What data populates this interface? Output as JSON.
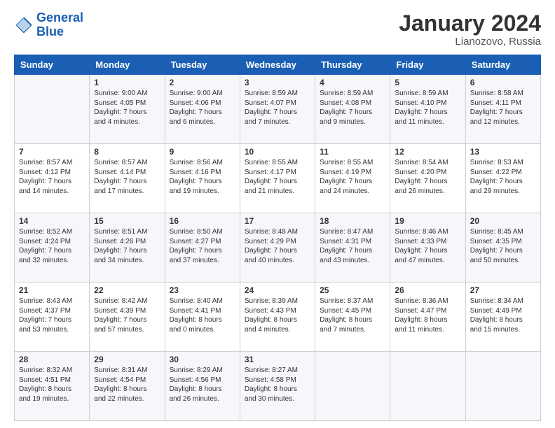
{
  "header": {
    "logo_general": "General",
    "logo_blue": "Blue",
    "month_title": "January 2024",
    "location": "Lianozovo, Russia"
  },
  "weekdays": [
    "Sunday",
    "Monday",
    "Tuesday",
    "Wednesday",
    "Thursday",
    "Friday",
    "Saturday"
  ],
  "weeks": [
    [
      {
        "day": "",
        "info": ""
      },
      {
        "day": "1",
        "info": "Sunrise: 9:00 AM\nSunset: 4:05 PM\nDaylight: 7 hours\nand 4 minutes."
      },
      {
        "day": "2",
        "info": "Sunrise: 9:00 AM\nSunset: 4:06 PM\nDaylight: 7 hours\nand 6 minutes."
      },
      {
        "day": "3",
        "info": "Sunrise: 8:59 AM\nSunset: 4:07 PM\nDaylight: 7 hours\nand 7 minutes."
      },
      {
        "day": "4",
        "info": "Sunrise: 8:59 AM\nSunset: 4:08 PM\nDaylight: 7 hours\nand 9 minutes."
      },
      {
        "day": "5",
        "info": "Sunrise: 8:59 AM\nSunset: 4:10 PM\nDaylight: 7 hours\nand 11 minutes."
      },
      {
        "day": "6",
        "info": "Sunrise: 8:58 AM\nSunset: 4:11 PM\nDaylight: 7 hours\nand 12 minutes."
      }
    ],
    [
      {
        "day": "7",
        "info": "Sunrise: 8:57 AM\nSunset: 4:12 PM\nDaylight: 7 hours\nand 14 minutes."
      },
      {
        "day": "8",
        "info": "Sunrise: 8:57 AM\nSunset: 4:14 PM\nDaylight: 7 hours\nand 17 minutes."
      },
      {
        "day": "9",
        "info": "Sunrise: 8:56 AM\nSunset: 4:16 PM\nDaylight: 7 hours\nand 19 minutes."
      },
      {
        "day": "10",
        "info": "Sunrise: 8:55 AM\nSunset: 4:17 PM\nDaylight: 7 hours\nand 21 minutes."
      },
      {
        "day": "11",
        "info": "Sunrise: 8:55 AM\nSunset: 4:19 PM\nDaylight: 7 hours\nand 24 minutes."
      },
      {
        "day": "12",
        "info": "Sunrise: 8:54 AM\nSunset: 4:20 PM\nDaylight: 7 hours\nand 26 minutes."
      },
      {
        "day": "13",
        "info": "Sunrise: 8:53 AM\nSunset: 4:22 PM\nDaylight: 7 hours\nand 29 minutes."
      }
    ],
    [
      {
        "day": "14",
        "info": "Sunrise: 8:52 AM\nSunset: 4:24 PM\nDaylight: 7 hours\nand 32 minutes."
      },
      {
        "day": "15",
        "info": "Sunrise: 8:51 AM\nSunset: 4:26 PM\nDaylight: 7 hours\nand 34 minutes."
      },
      {
        "day": "16",
        "info": "Sunrise: 8:50 AM\nSunset: 4:27 PM\nDaylight: 7 hours\nand 37 minutes."
      },
      {
        "day": "17",
        "info": "Sunrise: 8:48 AM\nSunset: 4:29 PM\nDaylight: 7 hours\nand 40 minutes."
      },
      {
        "day": "18",
        "info": "Sunrise: 8:47 AM\nSunset: 4:31 PM\nDaylight: 7 hours\nand 43 minutes."
      },
      {
        "day": "19",
        "info": "Sunrise: 8:46 AM\nSunset: 4:33 PM\nDaylight: 7 hours\nand 47 minutes."
      },
      {
        "day": "20",
        "info": "Sunrise: 8:45 AM\nSunset: 4:35 PM\nDaylight: 7 hours\nand 50 minutes."
      }
    ],
    [
      {
        "day": "21",
        "info": "Sunrise: 8:43 AM\nSunset: 4:37 PM\nDaylight: 7 hours\nand 53 minutes."
      },
      {
        "day": "22",
        "info": "Sunrise: 8:42 AM\nSunset: 4:39 PM\nDaylight: 7 hours\nand 57 minutes."
      },
      {
        "day": "23",
        "info": "Sunrise: 8:40 AM\nSunset: 4:41 PM\nDaylight: 8 hours\nand 0 minutes."
      },
      {
        "day": "24",
        "info": "Sunrise: 8:39 AM\nSunset: 4:43 PM\nDaylight: 8 hours\nand 4 minutes."
      },
      {
        "day": "25",
        "info": "Sunrise: 8:37 AM\nSunset: 4:45 PM\nDaylight: 8 hours\nand 7 minutes."
      },
      {
        "day": "26",
        "info": "Sunrise: 8:36 AM\nSunset: 4:47 PM\nDaylight: 8 hours\nand 11 minutes."
      },
      {
        "day": "27",
        "info": "Sunrise: 8:34 AM\nSunset: 4:49 PM\nDaylight: 8 hours\nand 15 minutes."
      }
    ],
    [
      {
        "day": "28",
        "info": "Sunrise: 8:32 AM\nSunset: 4:51 PM\nDaylight: 8 hours\nand 19 minutes."
      },
      {
        "day": "29",
        "info": "Sunrise: 8:31 AM\nSunset: 4:54 PM\nDaylight: 8 hours\nand 22 minutes."
      },
      {
        "day": "30",
        "info": "Sunrise: 8:29 AM\nSunset: 4:56 PM\nDaylight: 8 hours\nand 26 minutes."
      },
      {
        "day": "31",
        "info": "Sunrise: 8:27 AM\nSunset: 4:58 PM\nDaylight: 8 hours\nand 30 minutes."
      },
      {
        "day": "",
        "info": ""
      },
      {
        "day": "",
        "info": ""
      },
      {
        "day": "",
        "info": ""
      }
    ]
  ]
}
